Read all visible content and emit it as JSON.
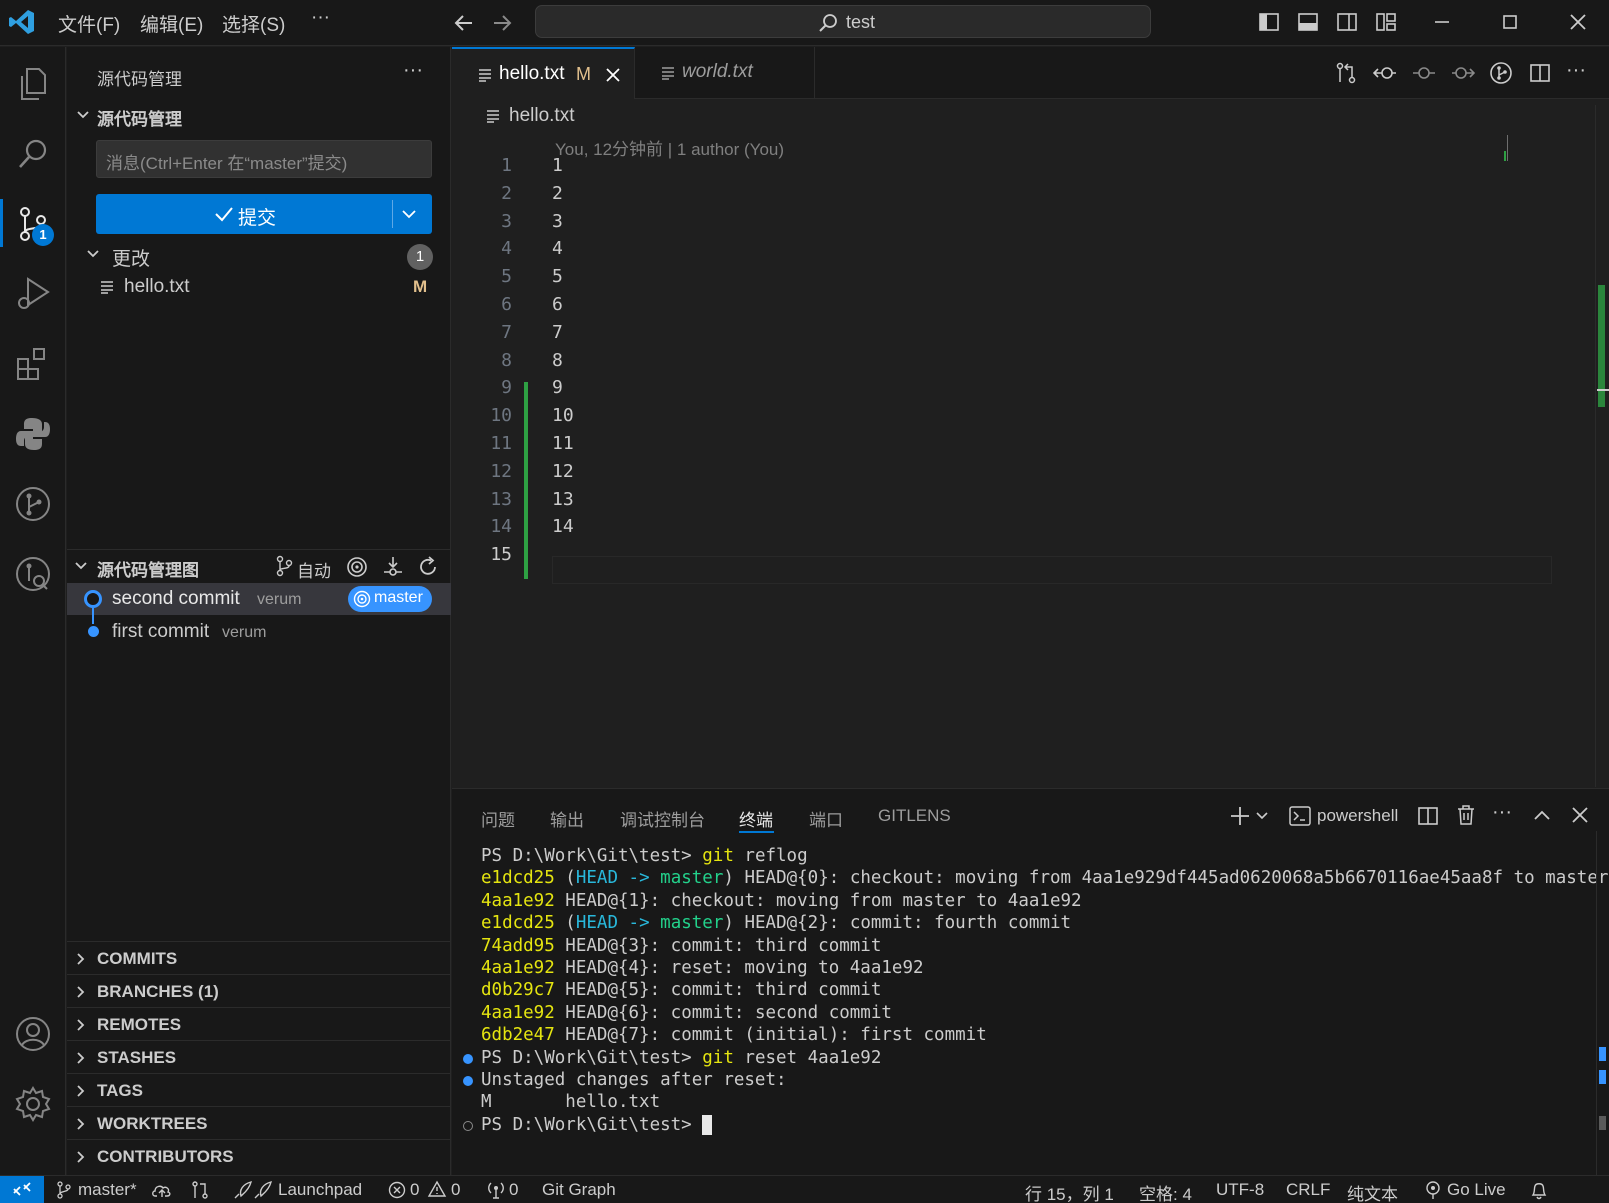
{
  "menu": {
    "file": "文件(F)",
    "edit": "编辑(E)",
    "select": "选择(S)",
    "more": "···"
  },
  "search": {
    "value": "test"
  },
  "sidebar": {
    "title": "源代码管理",
    "more": "···",
    "scm_section": "源代码管理",
    "commit_placeholder": "消息(Ctrl+Enter 在“master”提交)",
    "commit_label": "提交",
    "changes_label": "更改",
    "changes_count": "1",
    "changed_file": {
      "name": "hello.txt",
      "status": "M"
    },
    "scm_badge": "1",
    "graph": {
      "title": "源代码管理图",
      "auto_label": "自动",
      "commits": [
        {
          "message": "second commit",
          "author": "verum",
          "ref": "master"
        },
        {
          "message": "first commit",
          "author": "verum"
        }
      ]
    },
    "bottom_sections": [
      "COMMITS",
      "BRANCHES (1)",
      "REMOTES",
      "STASHES",
      "TAGS",
      "WORKTREES",
      "CONTRIBUTORS"
    ]
  },
  "editor": {
    "tabs": [
      {
        "label": "hello.txt",
        "status": "M"
      },
      {
        "label": "world.txt"
      }
    ],
    "breadcrumb": "hello.txt",
    "blame": "You, 12分钟前 | 1 author (You)",
    "lines": [
      "1",
      "2",
      "3",
      "4",
      "5",
      "6",
      "7",
      "8",
      "9",
      "10",
      "11",
      "12",
      "13",
      "14",
      ""
    ]
  },
  "panel": {
    "tabs": [
      "问题",
      "输出",
      "调试控制台",
      "终端",
      "端口",
      "GITLENS"
    ],
    "active_tab": "终端",
    "shell": "powershell",
    "terminal": [
      {
        "prompt": "PS D:\\Work\\Git\\test> ",
        "cmd": "git reflog"
      },
      {
        "hash": "e1dcd25",
        "ref": true,
        "text": " HEAD@{0}: checkout: moving from 4aa1e929df445ad0620068a5b6670116ae45aa8f to master"
      },
      {
        "hash": "4aa1e92",
        "text": " HEAD@{1}: checkout: moving from master to 4aa1e92"
      },
      {
        "hash": "e1dcd25",
        "ref": true,
        "text": " HEAD@{2}: commit: fourth commit"
      },
      {
        "hash": "74add95",
        "text": " HEAD@{3}: commit: third commit"
      },
      {
        "hash": "4aa1e92",
        "text": " HEAD@{4}: reset: moving to 4aa1e92"
      },
      {
        "hash": "d0b29c7",
        "text": " HEAD@{5}: commit: third commit"
      },
      {
        "hash": "4aa1e92",
        "text": " HEAD@{6}: commit: second commit"
      },
      {
        "hash": "6db2e47",
        "text": " HEAD@{7}: commit (initial): first commit"
      },
      {
        "prompt": "PS D:\\Work\\Git\\test> ",
        "cmd": "git reset 4aa1e92"
      },
      {
        "text": "Unstaged changes after reset:"
      },
      {
        "text": "M       hello.txt"
      },
      {
        "prompt": "PS D:\\Work\\Git\\test> "
      }
    ],
    "ref_text": {
      "open": "(",
      "head": "HEAD",
      "arrow": " -> ",
      "branch": "master",
      "close": ")"
    }
  },
  "status": {
    "branch": "master*",
    "errors": "0",
    "warnings": "0",
    "launchpad": "Launchpad",
    "ports": "0",
    "git_graph": "Git Graph",
    "position": "行 15，列 1",
    "spaces": "空格: 4",
    "encoding": "UTF-8",
    "eol": "CRLF",
    "language": "纯文本",
    "golive": "Go Live"
  },
  "colors": {
    "accent": "#0078d4",
    "modified": "#e2c08d",
    "added_gutter": "#2ea043",
    "graph_node": "#3794ff"
  }
}
